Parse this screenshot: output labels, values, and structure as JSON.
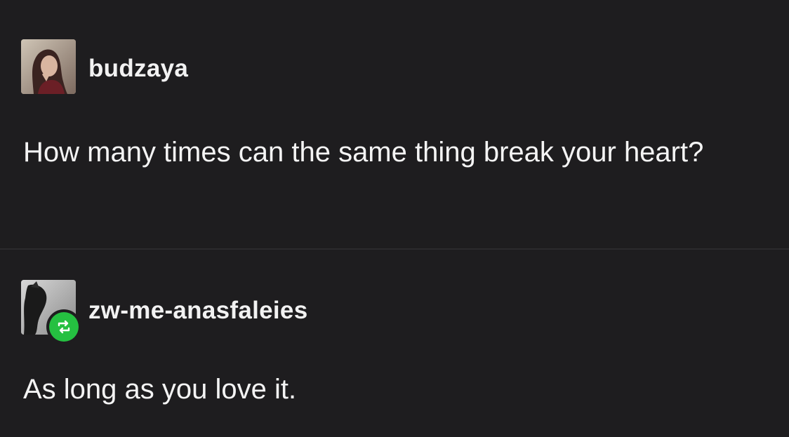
{
  "colors": {
    "background": "#1e1d1f",
    "text": "#f2f2f2",
    "divider": "#2b2a2d",
    "reblog_badge": "#25c041"
  },
  "posts": [
    {
      "username": "budzaya",
      "text": "How many times can the same thing break your heart?",
      "avatar_icon": "avatar-woman-portrait"
    },
    {
      "username": "zw-me-anasfaleies",
      "text": "As long as you love it.",
      "avatar_icon": "avatar-grayscale-photo",
      "badge_icon": "reblog-icon"
    }
  ]
}
